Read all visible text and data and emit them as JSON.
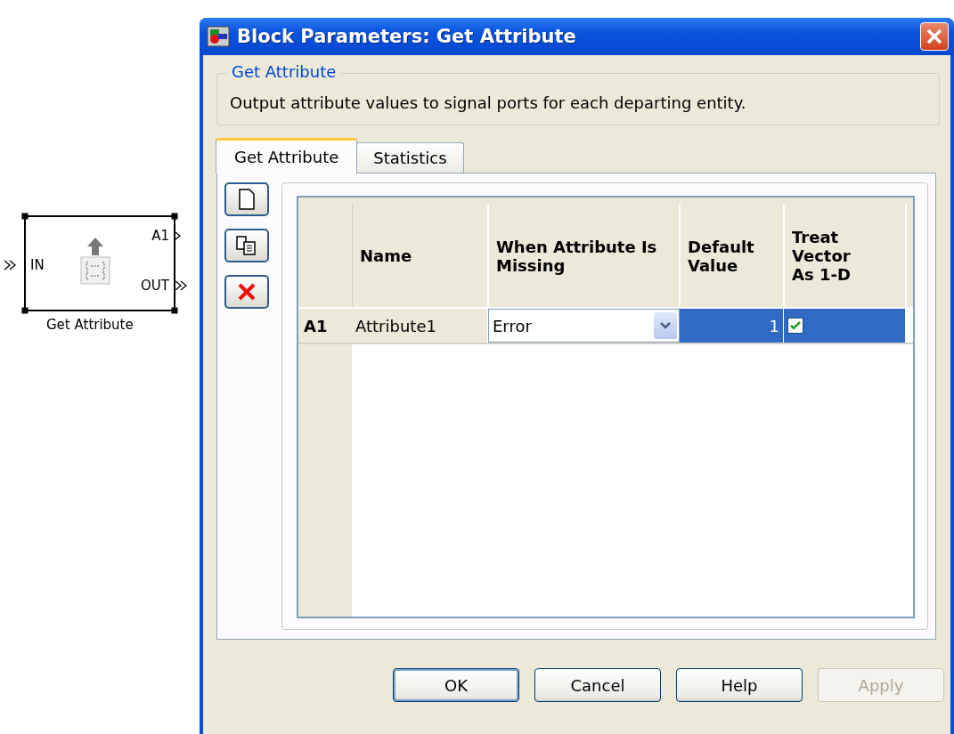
{
  "diagram_block": {
    "label": "Get Attribute",
    "input_ports": [
      {
        "label": "IN",
        "kind": "entity"
      }
    ],
    "output_ports": [
      {
        "label": "A1",
        "kind": "signal"
      },
      {
        "label": "OUT",
        "kind": "entity"
      }
    ]
  },
  "window": {
    "title": "Block Parameters: Get Attribute"
  },
  "description_group": {
    "title": "Get Attribute",
    "text": "Output attribute values to signal ports for each departing entity."
  },
  "tabs": [
    {
      "label": "Get Attribute",
      "selected": true
    },
    {
      "label": "Statistics",
      "selected": false
    }
  ],
  "table": {
    "columns": [
      "Name",
      "When Attribute Is Missing",
      "Default Value",
      "Treat Vector As 1-D"
    ],
    "rows": [
      {
        "header": "A1",
        "name": "Attribute1",
        "when_missing": "Error",
        "default_value": "1",
        "treat_vector": true,
        "selected": true
      }
    ]
  },
  "buttons": [
    {
      "label": "OK",
      "disabled": false
    },
    {
      "label": "Cancel",
      "disabled": false
    },
    {
      "label": "Help",
      "disabled": false
    },
    {
      "label": "Apply",
      "disabled": true
    }
  ]
}
